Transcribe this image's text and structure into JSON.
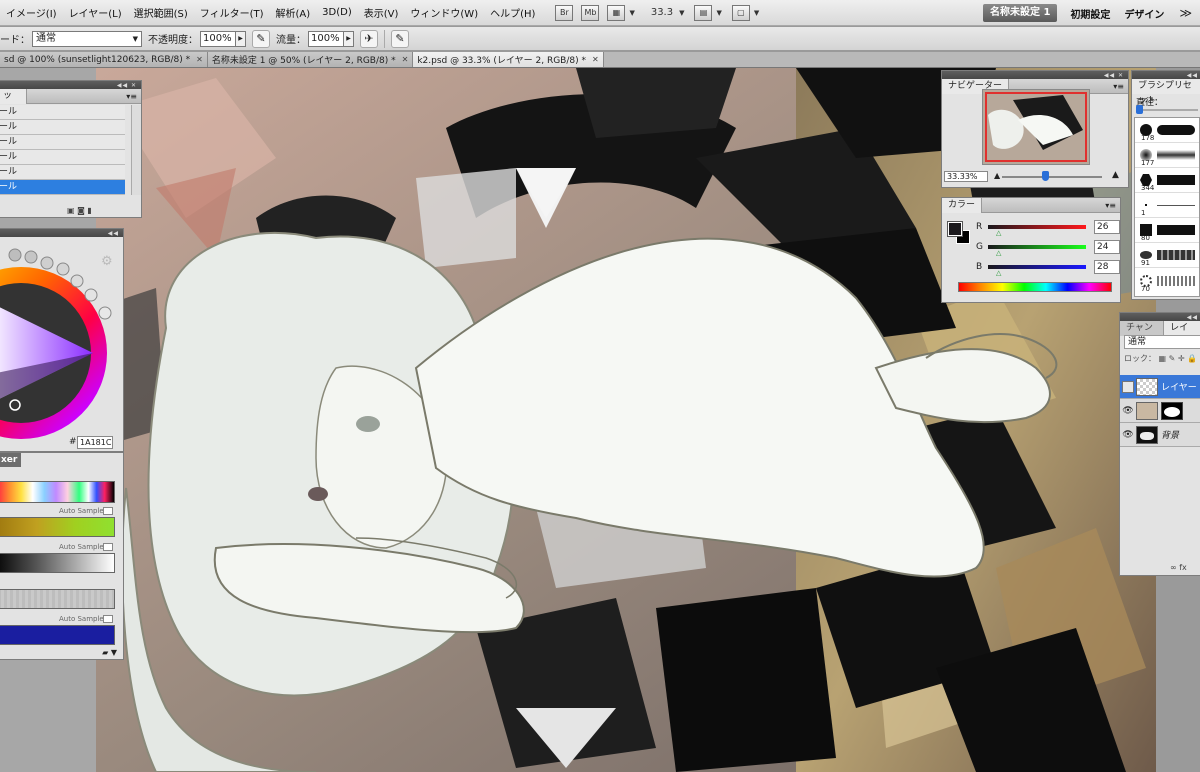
{
  "menubar": {
    "items": [
      "イメージ(I)",
      "レイヤー(L)",
      "選択範囲(S)",
      "フィルター(T)",
      "解析(A)",
      "3D(D)",
      "表示(V)",
      "ウィンドウ(W)",
      "ヘルプ(H)"
    ],
    "br_label": "Br",
    "mb_label": "Mb",
    "zoom": "33.3",
    "workspaces": [
      "名称未設定 1",
      "初期設定",
      "デザイン"
    ],
    "more": "≫"
  },
  "options": {
    "mode_label": "ード：",
    "mode_value": "通常",
    "opacity_label": "不透明度：",
    "opacity_value": "100%",
    "flow_label": "流量：",
    "flow_value": "100%"
  },
  "tabs": [
    {
      "label": "sd @ 100% (sunsetlight120623, RGB/8) *"
    },
    {
      "label": "名称未設定 1 @ 50% (レイヤー 2, RGB/8) *"
    },
    {
      "label": "k2.psd @ 33.3% (レイヤー 2, RGB/8) *"
    }
  ],
  "navigator": {
    "title": "ナビゲーター",
    "zoom": "33.33%"
  },
  "color_panel": {
    "title": "カラー",
    "fg_color": "#1a181c",
    "r_label": "R",
    "r_value": "26",
    "g_label": "G",
    "g_value": "24",
    "b_label": "B",
    "b_value": "28"
  },
  "brush_presets": {
    "title": "ブラシプリセット",
    "diameter_label": "直径：",
    "brushes": [
      {
        "size": "178"
      },
      {
        "size": "177"
      },
      {
        "size": "344"
      },
      {
        "size": "1"
      },
      {
        "size": "80"
      },
      {
        "size": "91"
      },
      {
        "size": "70"
      }
    ]
  },
  "layers": {
    "tabs": [
      "チャンネル",
      "レイヤー"
    ],
    "blend_mode": "通常",
    "lock_label": "ロック：",
    "rows": [
      {
        "name": "レイヤー",
        "selected": true
      },
      {
        "name": "",
        "selected": false
      },
      {
        "name": "背景",
        "selected": false
      }
    ]
  },
  "tool_panel": {
    "items": [
      "ール",
      "ール",
      "ール",
      "ール",
      "ール",
      "ール"
    ]
  },
  "wheel_panel": {
    "hex": "1A181C",
    "hash": "#"
  },
  "mixer": {
    "title": "xer",
    "auto_sample": "Auto Sample"
  }
}
